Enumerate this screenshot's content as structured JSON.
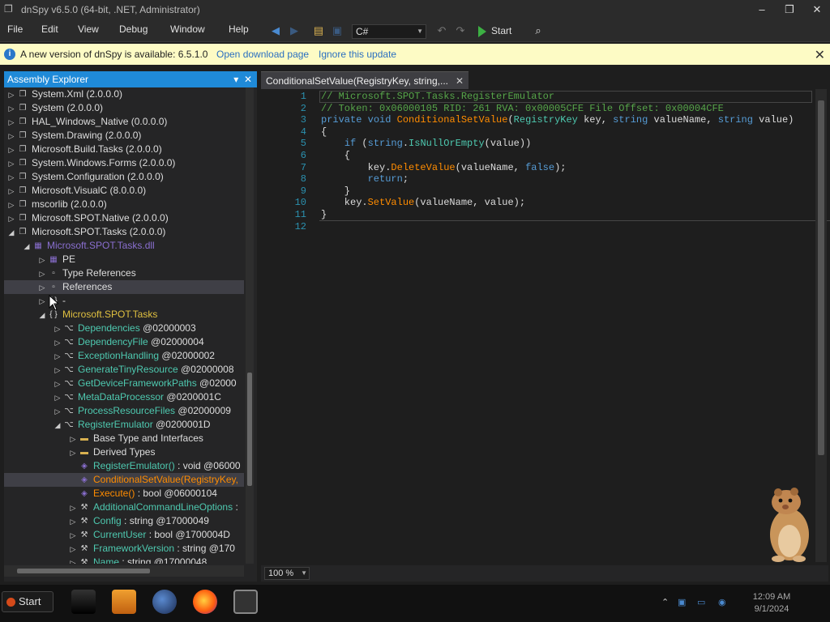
{
  "window": {
    "title": "dnSpy v6.5.0 (64-bit, .NET, Administrator)"
  },
  "menu": [
    "File",
    "Edit",
    "View",
    "Debug",
    "Window",
    "Help"
  ],
  "toolbar": {
    "language": "C#",
    "start_label": "Start"
  },
  "infobar": {
    "message": "A new version of dnSpy is available: 6.5.1.0",
    "download_link": "Open download page",
    "ignore_link": "Ignore this update"
  },
  "assembly_explorer": {
    "title": "Assembly Explorer",
    "tree": [
      {
        "label": "System.Xml (2.0.0.0)",
        "level": 0,
        "expander": "collapsed",
        "icon": "assembly-icon"
      },
      {
        "label": "System (2.0.0.0)",
        "level": 0,
        "expander": "collapsed",
        "icon": "assembly-icon"
      },
      {
        "label": "HAL_Windows_Native (0.0.0.0)",
        "level": 0,
        "expander": "collapsed",
        "icon": "assembly-icon"
      },
      {
        "label": "System.Drawing (2.0.0.0)",
        "level": 0,
        "expander": "collapsed",
        "icon": "assembly-icon"
      },
      {
        "label": "Microsoft.Build.Tasks (2.0.0.0)",
        "level": 0,
        "expander": "collapsed",
        "icon": "assembly-icon"
      },
      {
        "label": "System.Windows.Forms (2.0.0.0)",
        "level": 0,
        "expander": "collapsed",
        "icon": "assembly-icon"
      },
      {
        "label": "System.Configuration (2.0.0.0)",
        "level": 0,
        "expander": "collapsed",
        "icon": "assembly-icon"
      },
      {
        "label": "Microsoft.VisualC (8.0.0.0)",
        "level": 0,
        "expander": "collapsed",
        "icon": "assembly-icon"
      },
      {
        "label": "mscorlib (2.0.0.0)",
        "level": 0,
        "expander": "collapsed",
        "icon": "assembly-icon"
      },
      {
        "label": "Microsoft.SPOT.Native (2.0.0.0)",
        "level": 0,
        "expander": "collapsed",
        "icon": "assembly-icon"
      },
      {
        "label": "Microsoft.SPOT.Tasks (2.0.0.0)",
        "level": 0,
        "expander": "expanded",
        "icon": "assembly-icon"
      },
      {
        "label": "Microsoft.SPOT.Tasks.dll",
        "level": 1,
        "expander": "expanded",
        "icon": "module-icon",
        "color": "purple"
      },
      {
        "label": "PE",
        "level": 2,
        "expander": "collapsed",
        "icon": "pe-icon"
      },
      {
        "label": "Type References",
        "level": 2,
        "expander": "collapsed",
        "icon": "reference-icon"
      },
      {
        "label": "References",
        "level": 2,
        "expander": "collapsed",
        "icon": "reference-icon",
        "selected": true
      },
      {
        "label": "-",
        "level": 2,
        "expander": "collapsed",
        "icon": "namespace-icon"
      },
      {
        "label": "Microsoft.SPOT.Tasks",
        "level": 2,
        "expander": "expanded",
        "icon": "namespace-icon",
        "color": "yellow"
      },
      {
        "label": "Dependencies",
        "suffix": " @02000003",
        "level": 3,
        "expander": "collapsed",
        "icon": "class-icon",
        "color": "teal"
      },
      {
        "label": "DependencyFile",
        "suffix": " @02000004",
        "level": 3,
        "expander": "collapsed",
        "icon": "class-icon",
        "color": "teal"
      },
      {
        "label": "ExceptionHandling",
        "suffix": " @02000002",
        "level": 3,
        "expander": "collapsed",
        "icon": "class-icon",
        "color": "teal"
      },
      {
        "label": "GenerateTinyResource",
        "suffix": " @02000008",
        "level": 3,
        "expander": "collapsed",
        "icon": "class-icon",
        "color": "teal"
      },
      {
        "label": "GetDeviceFrameworkPaths",
        "suffix": " @02000",
        "level": 3,
        "expander": "collapsed",
        "icon": "class-icon",
        "color": "teal"
      },
      {
        "label": "MetaDataProcessor",
        "suffix": " @0200001C",
        "level": 3,
        "expander": "collapsed",
        "icon": "class-icon",
        "color": "teal"
      },
      {
        "label": "ProcessResourceFiles",
        "suffix": " @02000009",
        "level": 3,
        "expander": "collapsed",
        "icon": "class-icon",
        "color": "teal"
      },
      {
        "label": "RegisterEmulator",
        "suffix": " @0200001D",
        "level": 3,
        "expander": "expanded",
        "icon": "class-icon",
        "color": "teal"
      },
      {
        "label": "Base Type and Interfaces",
        "level": 4,
        "expander": "collapsed",
        "icon": "folder-icon"
      },
      {
        "label": "Derived Types",
        "level": 4,
        "expander": "collapsed",
        "icon": "folder-icon"
      },
      {
        "label": "RegisterEmulator()",
        "suffix": " : void @06000",
        "level": 4,
        "expander": "none",
        "icon": "method-icon",
        "color": "teal"
      },
      {
        "label": "ConditionalSetValue(RegistryKey,",
        "level": 4,
        "expander": "none",
        "icon": "private-method-icon",
        "color": "orange",
        "selected": true
      },
      {
        "label": "Execute()",
        "suffix": " : bool @06000104",
        "level": 4,
        "expander": "none",
        "icon": "method-icon",
        "color": "orange"
      },
      {
        "label": "AdditionalCommandLineOptions",
        "suffix": " :",
        "level": 4,
        "expander": "collapsed",
        "icon": "property-icon",
        "color": "teal"
      },
      {
        "label": "Config",
        "suffix": " : string @17000049",
        "level": 4,
        "expander": "collapsed",
        "icon": "property-icon",
        "color": "teal"
      },
      {
        "label": "CurrentUser",
        "suffix": " : bool @1700004D",
        "level": 4,
        "expander": "collapsed",
        "icon": "property-icon",
        "color": "teal"
      },
      {
        "label": "FrameworkVersion",
        "suffix": " : string @170",
        "level": 4,
        "expander": "collapsed",
        "icon": "property-icon",
        "color": "teal"
      },
      {
        "label": "Name",
        "suffix": " : string @17000048",
        "level": 4,
        "expander": "collapsed",
        "icon": "property-icon",
        "color": "teal"
      }
    ]
  },
  "editor": {
    "tab_label": "ConditionalSetValue(RegistryKey, string,...",
    "zoom": "100 %",
    "line_numbers": [
      "1",
      "2",
      "3",
      "4",
      "5",
      "6",
      "7",
      "8",
      "9",
      "10",
      "11",
      "12"
    ],
    "lines": [
      [
        {
          "t": "// Microsoft.SPOT.Tasks.RegisterEmulator",
          "c": "cmt"
        }
      ],
      [
        {
          "t": "// Token: 0x06000105 RID: 261 RVA: 0x00005CFE File Offset: 0x00004CFE",
          "c": "cmt"
        }
      ],
      [
        {
          "t": "private",
          "c": "kw"
        },
        {
          "t": " "
        },
        {
          "t": "void",
          "c": "kw"
        },
        {
          "t": " "
        },
        {
          "t": "ConditionalSetValue",
          "c": "meth"
        },
        {
          "t": "("
        },
        {
          "t": "RegistryKey",
          "c": "typ"
        },
        {
          "t": " key, "
        },
        {
          "t": "string",
          "c": "kw"
        },
        {
          "t": " valueName, "
        },
        {
          "t": "string",
          "c": "kw"
        },
        {
          "t": " value)"
        }
      ],
      [
        {
          "t": "{"
        }
      ],
      [
        {
          "t": "    "
        },
        {
          "t": "if",
          "c": "kw"
        },
        {
          "t": " ("
        },
        {
          "t": "string",
          "c": "kw"
        },
        {
          "t": "."
        },
        {
          "t": "IsNullOrEmpty",
          "c": "typ"
        },
        {
          "t": "(value))"
        }
      ],
      [
        {
          "t": "    {"
        }
      ],
      [
        {
          "t": "        key."
        },
        {
          "t": "DeleteValue",
          "c": "meth"
        },
        {
          "t": "(valueName, "
        },
        {
          "t": "false",
          "c": "kw"
        },
        {
          "t": ");"
        }
      ],
      [
        {
          "t": "        "
        },
        {
          "t": "return",
          "c": "kw"
        },
        {
          "t": ";"
        }
      ],
      [
        {
          "t": "    }"
        }
      ],
      [
        {
          "t": "    key."
        },
        {
          "t": "SetValue",
          "c": "meth"
        },
        {
          "t": "(valueName, value);"
        }
      ],
      [
        {
          "t": "}"
        }
      ],
      [
        {
          "t": ""
        }
      ]
    ]
  },
  "taskbar": {
    "start_label": "Start",
    "time": "12:09 AM",
    "date": "9/1/2024"
  }
}
